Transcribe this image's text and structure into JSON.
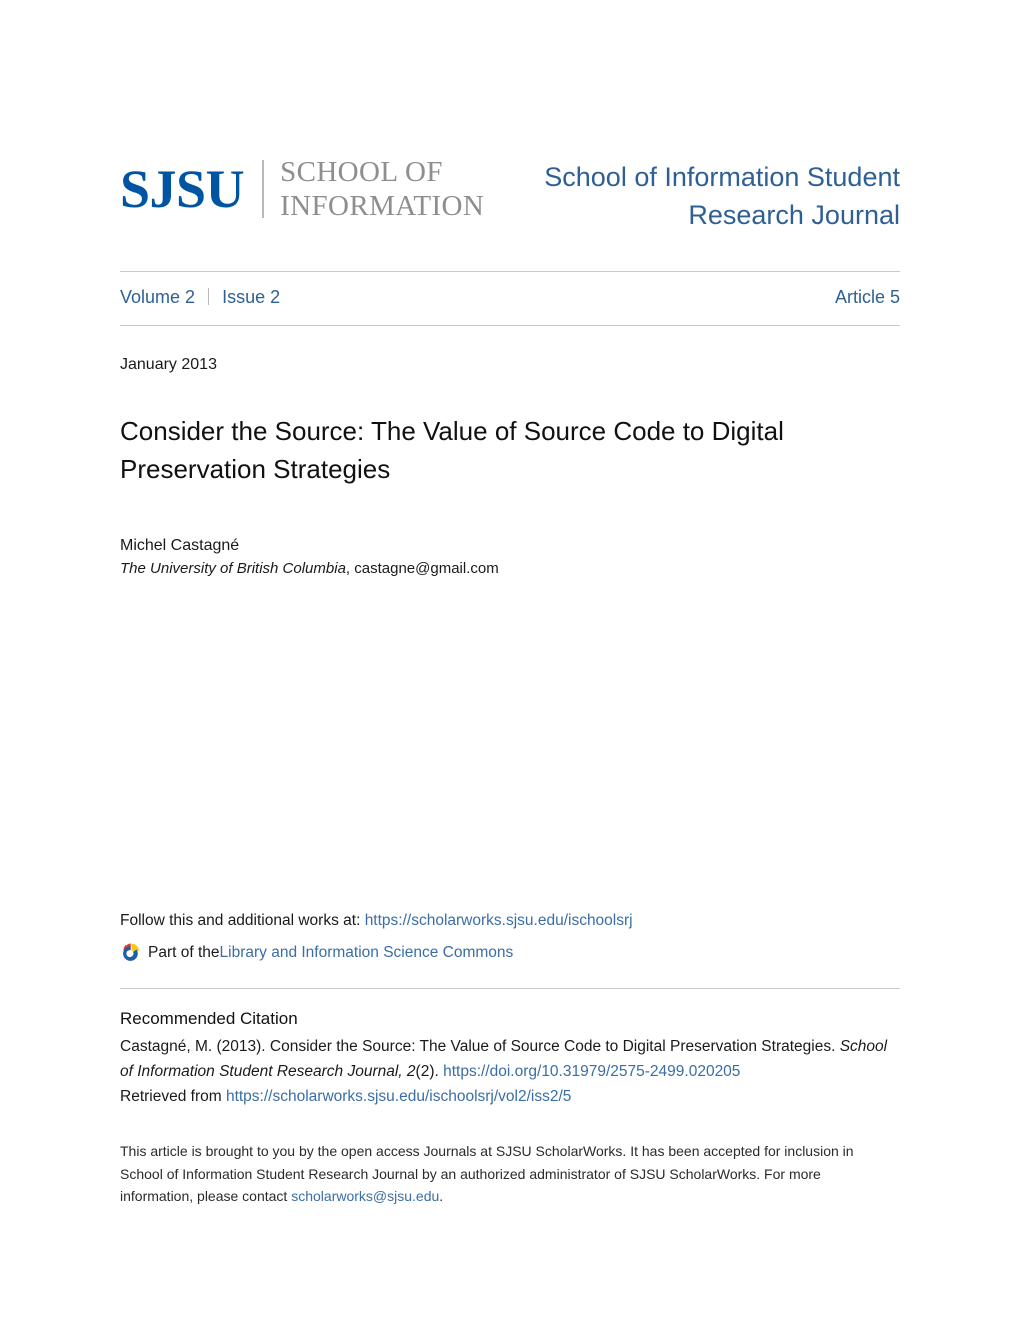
{
  "logo": {
    "wordmark": "SJSU",
    "school_line1": "SCHOOL OF",
    "school_line2": "INFORMATION",
    "brand_blue": "#0055a2",
    "school_gray": "#8e8e8e"
  },
  "header": {
    "journal_title": "School of Information Student Research Journal",
    "journal_blue": "#2f6095"
  },
  "issue_bar": {
    "volume": "Volume 2",
    "separator": "|",
    "issue": "Issue 2",
    "article": "Article 5"
  },
  "article": {
    "date": "January 2013",
    "title": "Consider the Source: The Value of Source Code to Digital Preservation Strategies",
    "author": "Michel Castagné",
    "institution": "The University of British Columbia",
    "institution_suffix": ", castagne@gmail.com"
  },
  "follow": {
    "prefix": "Follow this and additional works at: ",
    "url": "https://scholarworks.sjsu.edu/ischoolsrj",
    "commons_prefix": "Part of the ",
    "commons_link": "Library and Information Science Commons",
    "icon": "digital-commons-icon"
  },
  "citation": {
    "heading": "Recommended Citation",
    "line1": "Castagné, M. (2013). Consider the Source: The Value of Source Code to Digital Preservation Strategies.",
    "journal_italic": "School of Information Student Research Journal, 2",
    "issue_paren": "(2). ",
    "doi": "https://doi.org/10.31979/2575-2499.020205",
    "retrieved_prefix": "Retrieved from ",
    "retrieved_url": "https://scholarworks.sjsu.edu/ischoolsrj/vol2/iss2/5"
  },
  "footer": {
    "text_before_email": "This article is brought to you by the open access Journals at SJSU ScholarWorks. It has been accepted for inclusion in School of Information Student Research Journal by an authorized administrator of SJSU ScholarWorks. For more information, please contact ",
    "email": "scholarworks@sjsu.edu",
    "text_after_email": "."
  }
}
